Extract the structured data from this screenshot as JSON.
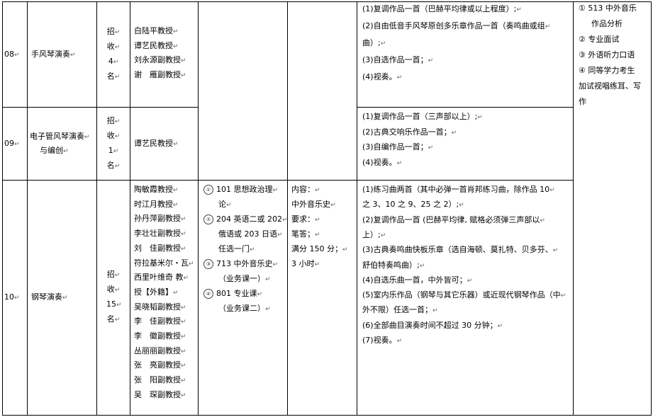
{
  "rows": [
    {
      "code": "08",
      "name": "手风琴演奏",
      "enroll": [
        "招",
        "收",
        "4",
        "名"
      ],
      "teachers": [
        "白陆平教授",
        "谭艺民教授",
        "刘永源副教授",
        "谢　雁副教授"
      ],
      "reqs": [
        "(1)复调作品一首（巴赫平均律或以上程度）;",
        "(2)自由低音手风琴原创多乐章作品一首（奏鸣曲或组",
        "曲）;",
        "(3)自选作品一首；",
        "(4)视奏。"
      ]
    },
    {
      "code": "09",
      "name_lines": [
        "电子管风琴演奏",
        "与编创"
      ],
      "enroll": [
        "招",
        "收",
        "1",
        "名"
      ],
      "teachers": [
        "谭艺民教授"
      ],
      "reqs": [
        "(1)复调作品一首（三声部以上）;",
        "(2)古典交响乐作品一首；",
        "(3)自编作品一首；",
        "(4)视奏。"
      ]
    },
    {
      "code": "10",
      "name": "钢琴演奏",
      "enroll": [
        "招",
        "收",
        "15",
        "名"
      ],
      "teachers": [
        "陶敏霞教授",
        "时江月教授",
        "孙丹萍副教授",
        "李壮壮副教授",
        "刘　佳副教授",
        "符拉基米尔・瓦",
        "西里叶维奇 教",
        "授【外籍】",
        "吴晓韬副教授",
        "李　佳副教授",
        "李　徽副教授",
        "丛丽丽副教授",
        "张　亮副教授",
        "张　阳副教授",
        "吴　琛副教授"
      ],
      "exams": [
        {
          "marker": "①",
          "lines": [
            "101 思想政治理",
            "论"
          ]
        },
        {
          "marker": "②",
          "lines": [
            "204 英语二或 202",
            "俄语或 203 日语",
            "任选一门"
          ]
        },
        {
          "marker": "③",
          "lines": [
            "713 中外音乐史",
            "（业务课一）"
          ]
        },
        {
          "marker": "④",
          "lines": [
            "801 专业课",
            "（业务课二）"
          ]
        }
      ],
      "content": [
        "内容：",
        "中外音乐史",
        "要求：",
        "笔答；",
        "满分 150 分；",
        "3 小时"
      ],
      "reqs": [
        "(1)练习曲两首（其中必弹一首肖邦练习曲，除作品 10",
        "之 3、10 之 9、25 之 2）;",
        "(2)复调作品一首 (巴赫平均律, 赋格必须弹三声部以",
        "上）;",
        "(3)古典奏鸣曲快板乐章（选自海顿、莫扎特、贝多芬、",
        "舒伯特奏鸣曲）;",
        "(4)自选乐曲一首，中外皆可；",
        "(5)室内乐作品（钢琴与其它乐器）或近现代钢琴作品（中",
        "外不限）任选一首；",
        "(6)全部曲目演奏时间不超过 30 分钟；",
        "(7)视奏。"
      ]
    }
  ],
  "retest": [
    {
      "marker": "①",
      "lines": [
        "513 中外音乐",
        "作品分析"
      ]
    },
    {
      "marker": "②",
      "lines": [
        "专业面试"
      ]
    },
    {
      "marker": "③",
      "lines": [
        "外语听力口语"
      ]
    },
    {
      "marker": "④",
      "lines": [
        "同等学力考生",
        "加试视唱练耳、写",
        "作"
      ]
    }
  ],
  "paragraph_mark": "↵"
}
